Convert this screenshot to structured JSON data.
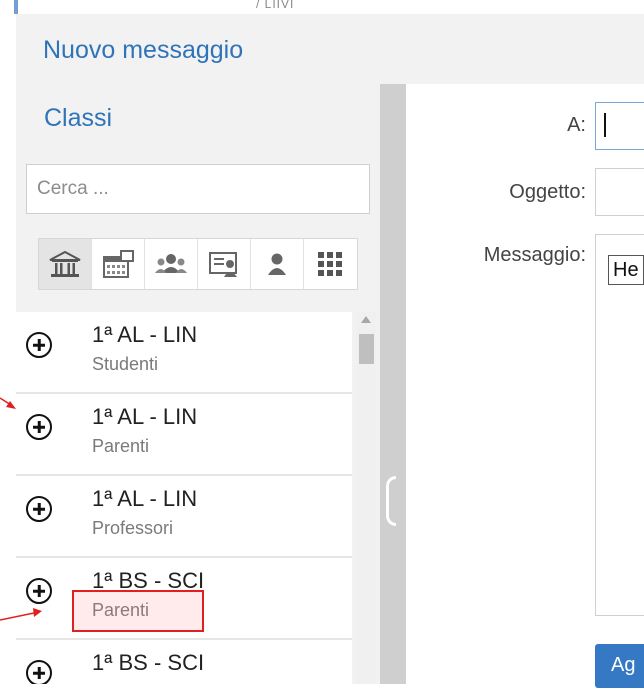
{
  "window": {
    "top_fragment": "/ LIIVI"
  },
  "dialog": {
    "title": "Nuovo messaggio"
  },
  "left_panel": {
    "heading": "Classi",
    "search": {
      "placeholder": "Cerca ...",
      "value": ""
    },
    "toolbar": [
      {
        "icon": "school-building-icon",
        "active": true
      },
      {
        "icon": "calendar-classes-icon",
        "active": false
      },
      {
        "icon": "group-users-icon",
        "active": false
      },
      {
        "icon": "id-card-icon",
        "active": false
      },
      {
        "icon": "single-user-icon",
        "active": false
      },
      {
        "icon": "grid-apps-icon",
        "active": false
      }
    ],
    "items": [
      {
        "name": "1ª AL - LIN",
        "role": "Studenti"
      },
      {
        "name": "1ª AL - LIN",
        "role": "Parenti"
      },
      {
        "name": "1ª AL - LIN",
        "role": "Professori"
      },
      {
        "name": "1ª BS - SCI",
        "role": "Parenti"
      },
      {
        "name": "1ª BS - SCI",
        "role": ""
      }
    ]
  },
  "form": {
    "to_label": "A:",
    "subject_label": "Oggetto:",
    "message_label": "Messaggio:",
    "message_fragment": "He",
    "send_label": "Ag"
  },
  "colors": {
    "accent": "#2f74b8",
    "button": "#3578c4",
    "annotation": "#e21f1f"
  }
}
